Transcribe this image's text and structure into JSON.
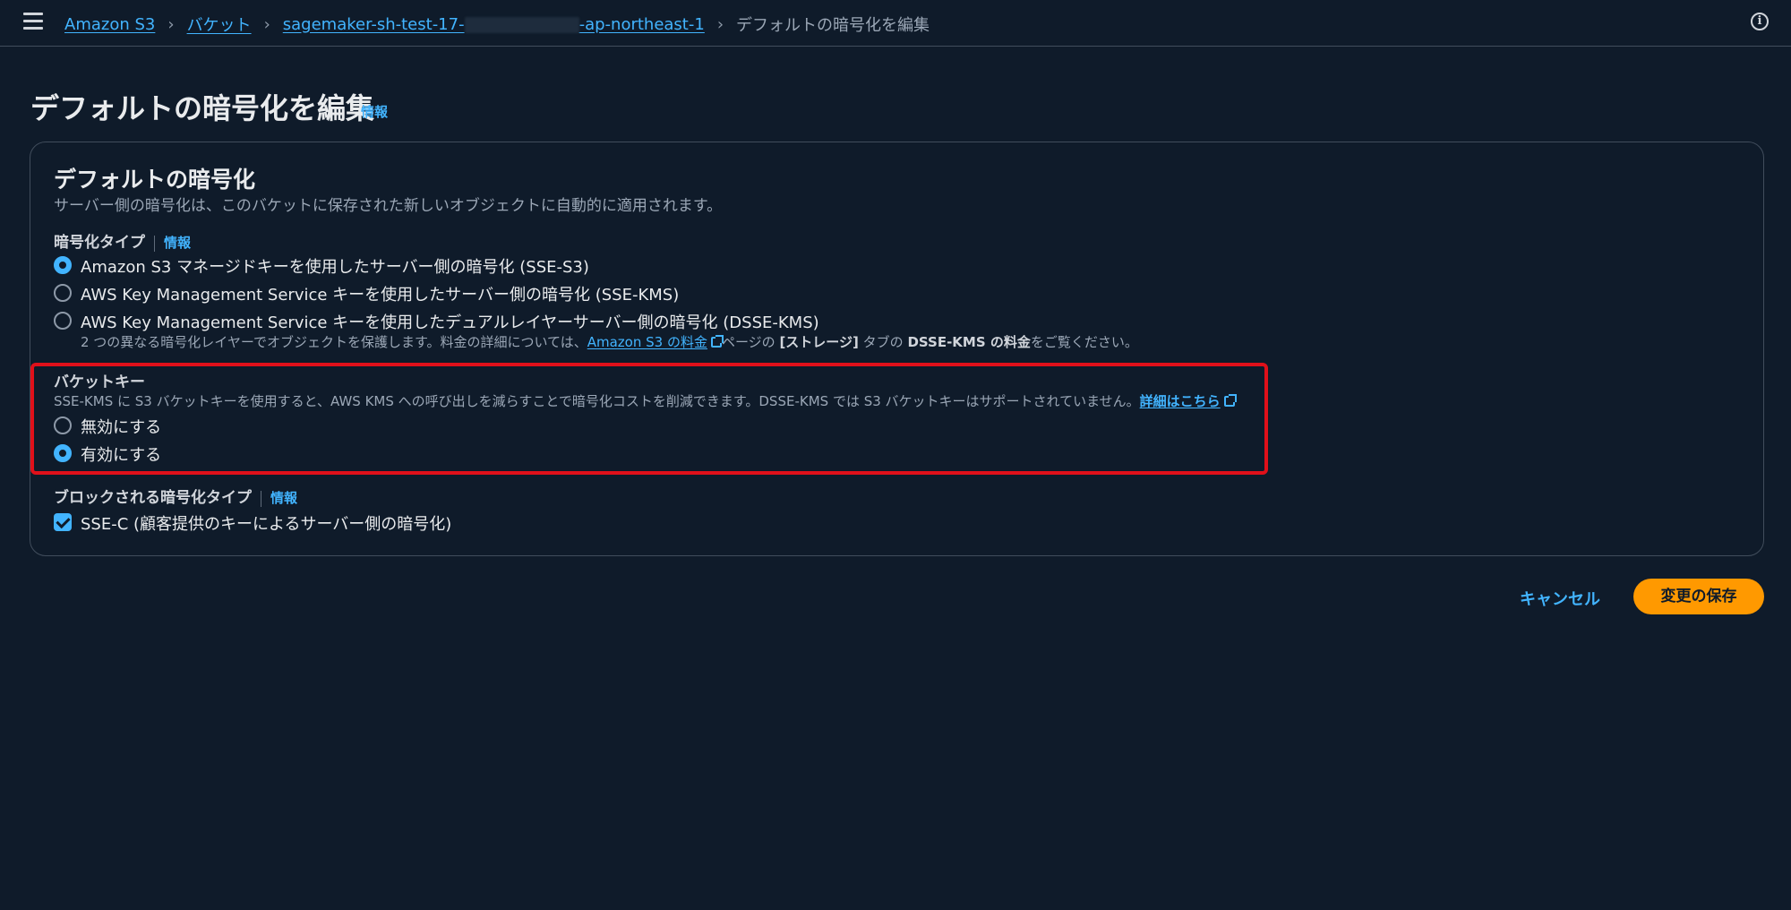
{
  "breadcrumbs": {
    "s3": "Amazon S3",
    "buckets": "バケット",
    "bucket_prefix": "sagemaker-sh-test-17-",
    "bucket_suffix": "-ap-northeast-1",
    "current": "デフォルトの暗号化を編集"
  },
  "page": {
    "title": "デフォルトの暗号化を編集",
    "info": "情報"
  },
  "panel": {
    "title": "デフォルトの暗号化",
    "description": "サーバー側の暗号化は、このバケットに保存された新しいオブジェクトに自動的に適用されます。",
    "encryption_type": {
      "label": "暗号化タイプ",
      "info": "情報",
      "options": [
        {
          "label": "Amazon S3 マネージドキーを使用したサーバー側の暗号化 (SSE-S3)",
          "checked": true
        },
        {
          "label": "AWS Key Management Service キーを使用したサーバー側の暗号化 (SSE-KMS)",
          "checked": false
        },
        {
          "label": "AWS Key Management Service キーを使用したデュアルレイヤーサーバー側の暗号化 (DSSE-KMS)",
          "checked": false
        }
      ],
      "dsse_desc_1": "2 つの異なる暗号化レイヤーでオブジェクトを保護します。料金の詳細については、",
      "dsse_link": "Amazon S3 の料金",
      "dsse_desc_2": "ページの",
      "dsse_bold_1": "[ストレージ]",
      "dsse_desc_3": "タブの",
      "dsse_bold_2": "DSSE-KMS の料金",
      "dsse_desc_4": "をご覧ください。"
    },
    "bucket_key": {
      "label": "バケットキー",
      "description": "SSE-KMS に S3 バケットキーを使用すると、AWS KMS への呼び出しを減らすことで暗号化コストを削減できます。DSSE-KMS では S3 バケットキーはサポートされていません。",
      "link": "詳細はこちら",
      "options": [
        {
          "label": "無効にする",
          "checked": false
        },
        {
          "label": "有効にする",
          "checked": true
        }
      ]
    },
    "blocked": {
      "label": "ブロックされる暗号化タイプ",
      "info": "情報",
      "checkbox_label": "SSE-C (顧客提供のキーによるサーバー側の暗号化)",
      "checked": true
    }
  },
  "actions": {
    "cancel": "キャンセル",
    "save": "変更の保存"
  },
  "colors": {
    "background": "#0f1b2a",
    "link": "#42b4ff",
    "primary_button": "#ff9900",
    "highlight": "#e0101a"
  }
}
